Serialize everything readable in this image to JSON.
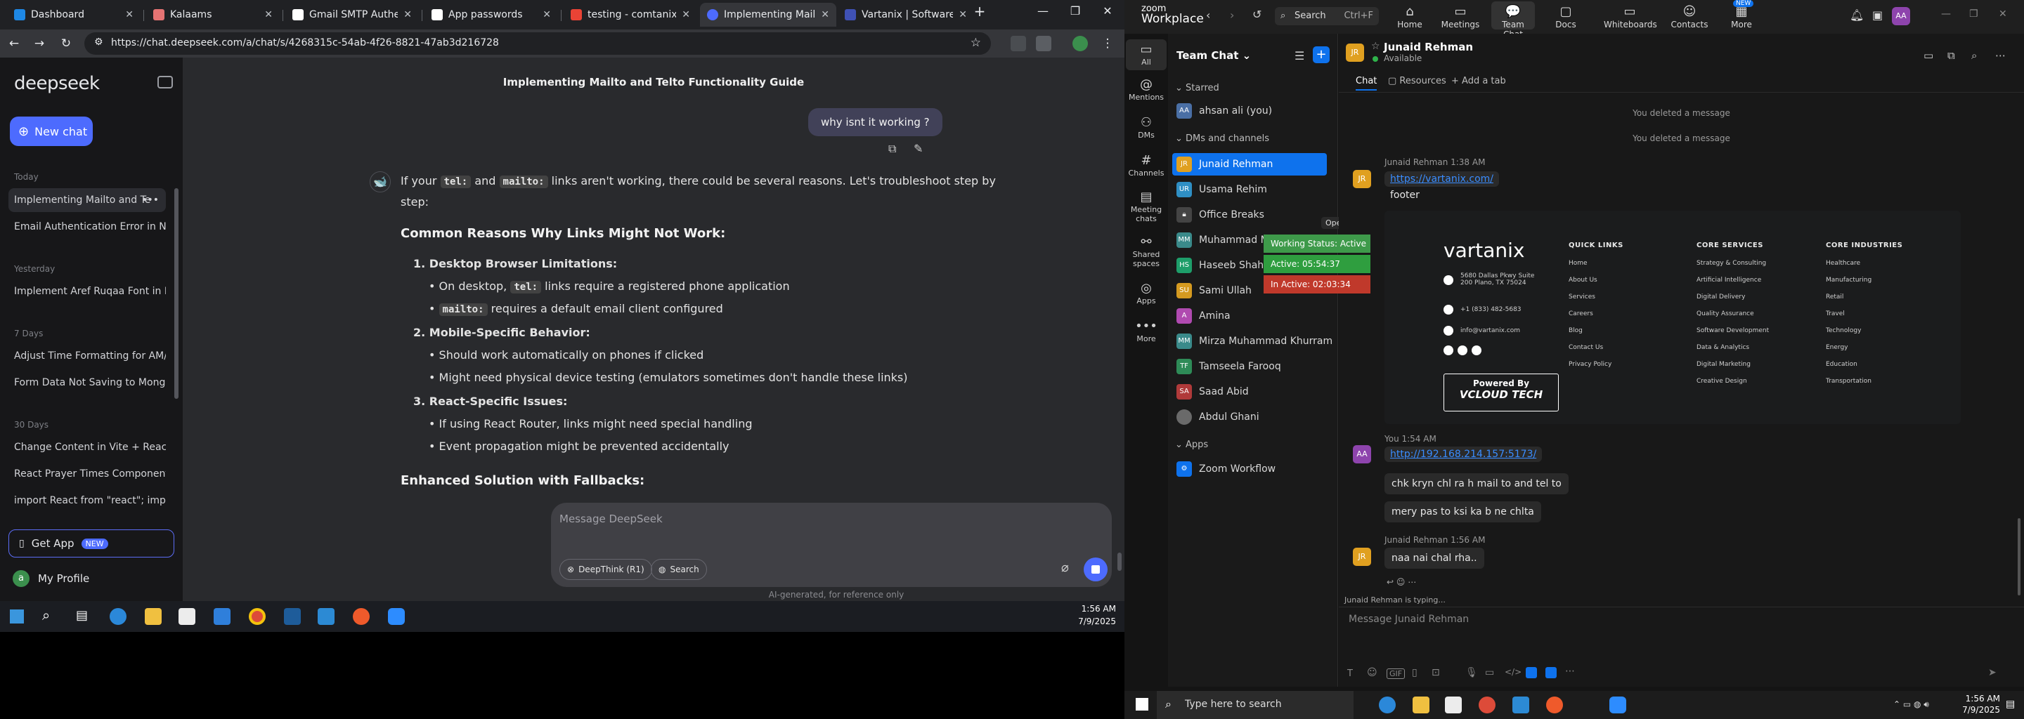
{
  "chrome": {
    "tabs": [
      {
        "label": "Dashboard",
        "color": "#1e88e5"
      },
      {
        "label": "Kalaams",
        "color": "#e57373"
      },
      {
        "label": "Gmail SMTP Authenticati",
        "color": "#ffffff"
      },
      {
        "label": "App passwords",
        "color": "#ffffff"
      },
      {
        "label": "testing - comtanixahs",
        "color": "#ea4335"
      },
      {
        "label": "Implementing Mailto a",
        "color": "#4d6bfe"
      },
      {
        "label": "Vartanix | Software De",
        "color": "#3f51b5"
      }
    ],
    "url": "https://chat.deepseek.com/a/chat/s/4268315c-54ab-4f26-8821-47ab3d216728"
  },
  "deepseek": {
    "logo": "deepseek",
    "new_chat": "New chat",
    "sections": {
      "today": "Today",
      "yesterday": "Yesterday",
      "seven_days": "7 Days",
      "thirty_days": "30 Days"
    },
    "history": {
      "today": [
        "Implementing Mailto and Te",
        "Email Authentication Error in No"
      ],
      "yesterday": [
        "Implement Aref Ruqaa Font in R"
      ],
      "seven_days": [
        "Adjust Time Formatting for AM/",
        "Form Data Not Saving to Mongo"
      ],
      "thirty_days": [
        "Change Content in Vite + React",
        "React Prayer Times Component",
        "import React from \"react\"; impor"
      ]
    },
    "get_app": "Get App",
    "new_badge": "NEW",
    "profile": "My Profile",
    "profile_initial": "a",
    "chat_title": "Implementing Mailto and Telto Functionality Guide",
    "user_message": "why isnt it working ?",
    "answer": {
      "intro_a": "If your",
      "code_tel": "tel:",
      "intro_b": "and",
      "code_mailto": "mailto:",
      "intro_c": "links aren't working, there could be several reasons. Let's troubleshoot step by",
      "intro_d": "step:",
      "heading1": "Common Reasons Why Links Might Not Work:",
      "item1": "Desktop Browser Limitations:",
      "item1_b1_a": "On desktop,",
      "item1_b1_code": "tel:",
      "item1_b1_b": "links require a registered phone application",
      "item1_b2_code": "mailto:",
      "item1_b2_b": "requires a default email client configured",
      "item2": "Mobile-Specific Behavior:",
      "item2_b1": "Should work automatically on phones if clicked",
      "item2_b2": "Might need physical device testing (emulators sometimes don't handle these links)",
      "item3": "React-Specific Issues:",
      "item3_b1": "If using React Router, links might need special handling",
      "item3_b2": "Event propagation might be prevented accidentally",
      "heading2": "Enhanced Solution with Fallbacks:"
    },
    "composer_placeholder": "Message DeepSeek",
    "deepthink": "DeepThink (R1)",
    "search": "Search",
    "footer_note": "AI-generated, for reference only"
  },
  "taskbar_left": {
    "time": "1:56 AM",
    "date": "7/9/2025"
  },
  "zoom": {
    "brand_top": "zoom",
    "brand_bottom": "Workplace",
    "search_label": "Search",
    "search_shortcut": "Ctrl+F",
    "nav": [
      "Home",
      "Meetings",
      "Team Chat",
      "Docs",
      "Whiteboards",
      "Contacts",
      "More"
    ],
    "nav_more_badge": "NEW",
    "user_initials": "AA",
    "rail": [
      "All",
      "Mentions",
      "DMs",
      "Channels",
      "Meeting chats",
      "Shared spaces",
      "Apps",
      "More"
    ],
    "list_title": "Team Chat",
    "starred": "Starred",
    "starred_items": [
      {
        "name": "ahsan ali (you)",
        "initials": "AA",
        "color": "#4a6fa5"
      }
    ],
    "dms_title": "DMs and channels",
    "dms": [
      {
        "name": "Junaid Rehman",
        "initials": "JR",
        "color": "#e0a020"
      },
      {
        "name": "Usama Rehim",
        "initials": "UR",
        "color": "#2f8fc4"
      },
      {
        "name": "Office Breaks",
        "initials": "",
        "color": "#444444"
      },
      {
        "name": "Muhammad M",
        "initials": "MM",
        "color": "#3a8a8a"
      },
      {
        "name": "Haseeb Shah",
        "initials": "HS",
        "color": "#1e9e6a"
      },
      {
        "name": "Sami Ullah",
        "initials": "SU",
        "color": "#d59a20"
      },
      {
        "name": "Amina",
        "initials": "A",
        "color": "#b04ab0"
      },
      {
        "name": "Mirza Muhammad Khurram",
        "initials": "MM",
        "color": "#3a8a8a"
      },
      {
        "name": "Tamseela Farooq",
        "initials": "TF",
        "color": "#2e8b57"
      },
      {
        "name": "Saad Abid",
        "initials": "SA",
        "color": "#b03a3a"
      },
      {
        "name": "Abdul Ghani",
        "initials": "",
        "color": "#6a6a6a"
      }
    ],
    "apps_title": "Apps",
    "apps": [
      "Zoom Workflow"
    ],
    "open_app": "Open App",
    "status_popup": [
      {
        "label": "Working Status: Active",
        "color": "#3e9a4a"
      },
      {
        "label": "Active: 05:54:37",
        "color": "#2f9e3f"
      },
      {
        "label": "In Active: 02:03:34",
        "color": "#c0392b"
      }
    ],
    "chat_name": "Junaid Rehman",
    "chat_status": "Available",
    "chat_tabs": [
      "Chat",
      "Resources",
      "Add a tab"
    ],
    "system_msgs": [
      "You deleted a message",
      "You deleted a message"
    ],
    "msg1_meta": "Junaid Rehman 1:38 AM",
    "msg1_link": "https://vartanix.com/",
    "msg1_text": "footer",
    "preview": {
      "logo": "vartanix",
      "address": "5680 Dallas Pkwy Suite 200 Plano, TX 75024",
      "phone": "+1 (833) 482-5683",
      "email": "info@vartanix.com",
      "quick_links_h": "QUICK LINKS",
      "quick_links": [
        "Home",
        "About Us",
        "Services",
        "Careers",
        "Blog",
        "Contact Us",
        "Privacy Policy"
      ],
      "core_services_h": "CORE SERVICES",
      "core_services": [
        "Strategy & Consulting",
        "Artificial Intelligence",
        "Digital Delivery",
        "Quality Assurance",
        "Software Development",
        "Data & Analytics",
        "Digital Marketing",
        "Creative Design"
      ],
      "core_industries_h": "CORE INDUSTRIES",
      "core_industries": [
        "Healthcare",
        "Manufacturing",
        "Retail",
        "Travel",
        "Technology",
        "Energy",
        "Education",
        "Transportation"
      ],
      "powered_by": "Powered By",
      "vcloud": "VCLOUD TECH"
    },
    "msg2_meta": "You 1:54 AM",
    "msg2_link": "http://192.168.214.157:5173/",
    "msg2_lines": [
      "chk kryn chl ra h mail to and tel to",
      "mery pas to ksi ka b ne chlta"
    ],
    "msg3_meta": "Junaid Rehman 1:56 AM",
    "msg3_text": "naa nai chal rha..",
    "typing": "Junaid Rehman is typing...",
    "composer_placeholder": "Message Junaid Rehman",
    "gif": "GIF"
  },
  "taskbar_right": {
    "search": "Type here to search",
    "time": "1:56 AM",
    "date": "7/9/2025"
  }
}
